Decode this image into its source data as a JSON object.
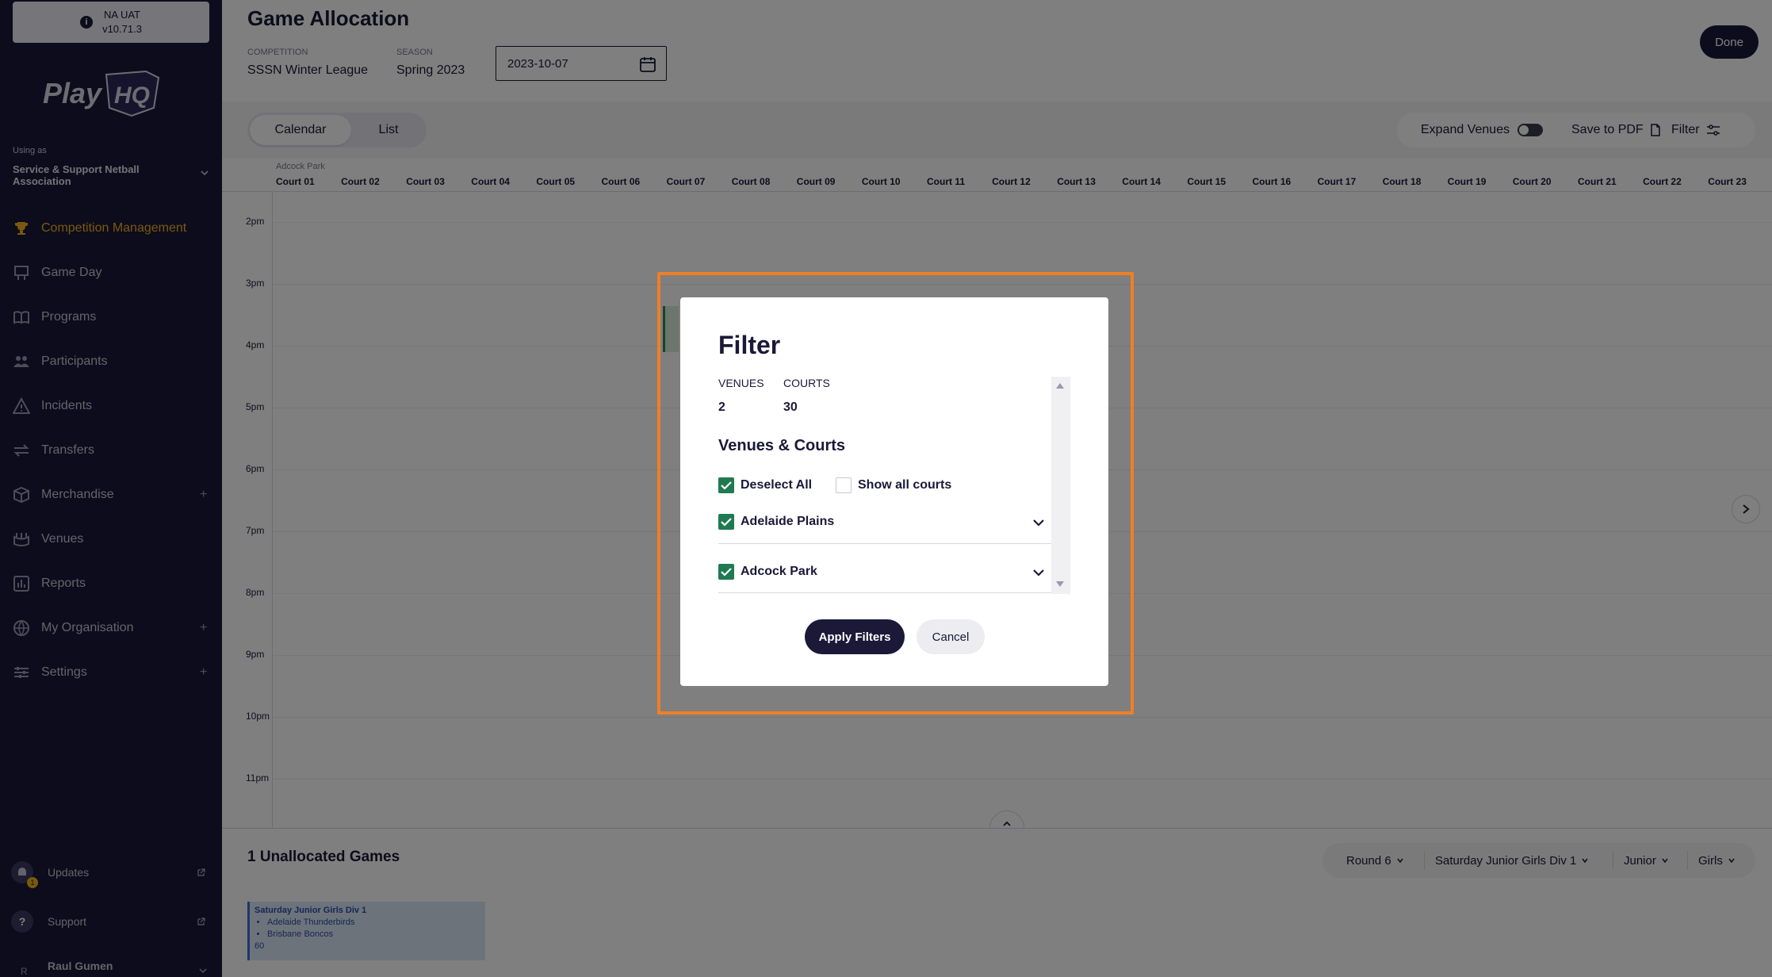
{
  "sidebar": {
    "env_name": "NA UAT",
    "env_version": "v10.71.3",
    "logo_text": "PlayHQ",
    "using_as_label": "Using as",
    "org_name": "Service & Support Netball Association",
    "nav": [
      {
        "label": "Competition Management",
        "icon": "trophy-icon",
        "active": true
      },
      {
        "label": "Game Day",
        "icon": "scoreboard-icon"
      },
      {
        "label": "Programs",
        "icon": "book-icon"
      },
      {
        "label": "Participants",
        "icon": "people-icon"
      },
      {
        "label": "Incidents",
        "icon": "warning-icon"
      },
      {
        "label": "Transfers",
        "icon": "transfer-arrows-icon"
      },
      {
        "label": "Merchandise",
        "icon": "box-icon",
        "expandable": "+"
      },
      {
        "label": "Venues",
        "icon": "stadium-icon"
      },
      {
        "label": "Reports",
        "icon": "report-chart-icon"
      },
      {
        "label": "My Organisation",
        "icon": "globe-icon",
        "expandable": "+"
      },
      {
        "label": "Settings",
        "icon": "sliders-icon",
        "expandable": "+"
      }
    ],
    "updates_label": "Updates",
    "updates_badge": "1",
    "support_label": "Support",
    "support_icon_text": "?",
    "user_name": "Raul Gumen",
    "user_initial": "R"
  },
  "header": {
    "title": "Game Allocation",
    "competition_label": "COMPETITION",
    "competition_value": "SSSN Winter League",
    "season_label": "SEASON",
    "season_value": "Spring 2023",
    "date_value": "2023-10-07",
    "done_label": "Done"
  },
  "toolbar": {
    "view_tabs": [
      "Calendar",
      "List"
    ],
    "active_tab": "Calendar",
    "expand_venues_label": "Expand Venues",
    "save_pdf_label": "Save to PDF",
    "filter_label": "Filter"
  },
  "calendar": {
    "venue": "Adcock Park",
    "courts": [
      "Court 01",
      "Court 02",
      "Court 03",
      "Court 04",
      "Court 05",
      "Court 06",
      "Court 07",
      "Court 08",
      "Court 09",
      "Court 10",
      "Court 11",
      "Court 12",
      "Court 13",
      "Court 14",
      "Court 15",
      "Court 16",
      "Court 17",
      "Court 18",
      "Court 19",
      "Court 20",
      "Court 21",
      "Court 22",
      "Court 23"
    ],
    "times": [
      "2pm",
      "3pm",
      "4pm",
      "5pm",
      "6pm",
      "7pm",
      "8pm",
      "9pm",
      "10pm",
      "11pm"
    ]
  },
  "unallocated": {
    "title": "1 Unallocated Games",
    "filters": [
      "Round 6",
      "Saturday Junior Girls Div 1",
      "Junior",
      "Girls"
    ],
    "game": {
      "title": "Saturday Junior Girls Div 1",
      "teams": [
        "Adelaide Thunderbirds",
        "Brisbane Boncos"
      ],
      "extra": "60"
    }
  },
  "modal": {
    "title": "Filter",
    "venues_label": "VENUES",
    "venues_count": "2",
    "courts_label": "COURTS",
    "courts_count": "30",
    "section_title": "Venues & Courts",
    "deselect_all_label": "Deselect All",
    "show_all_courts_label": "Show all courts",
    "venues": [
      {
        "name": "Adelaide Plains",
        "checked": true
      },
      {
        "name": "Adcock Park",
        "checked": true
      }
    ],
    "apply_label": "Apply Filters",
    "cancel_label": "Cancel"
  },
  "colors": {
    "brand_dark": "#1b1838",
    "accent_gold": "#f3b21a",
    "checkbox_green": "#1f7a52",
    "highlight_orange": "#f07f24"
  }
}
